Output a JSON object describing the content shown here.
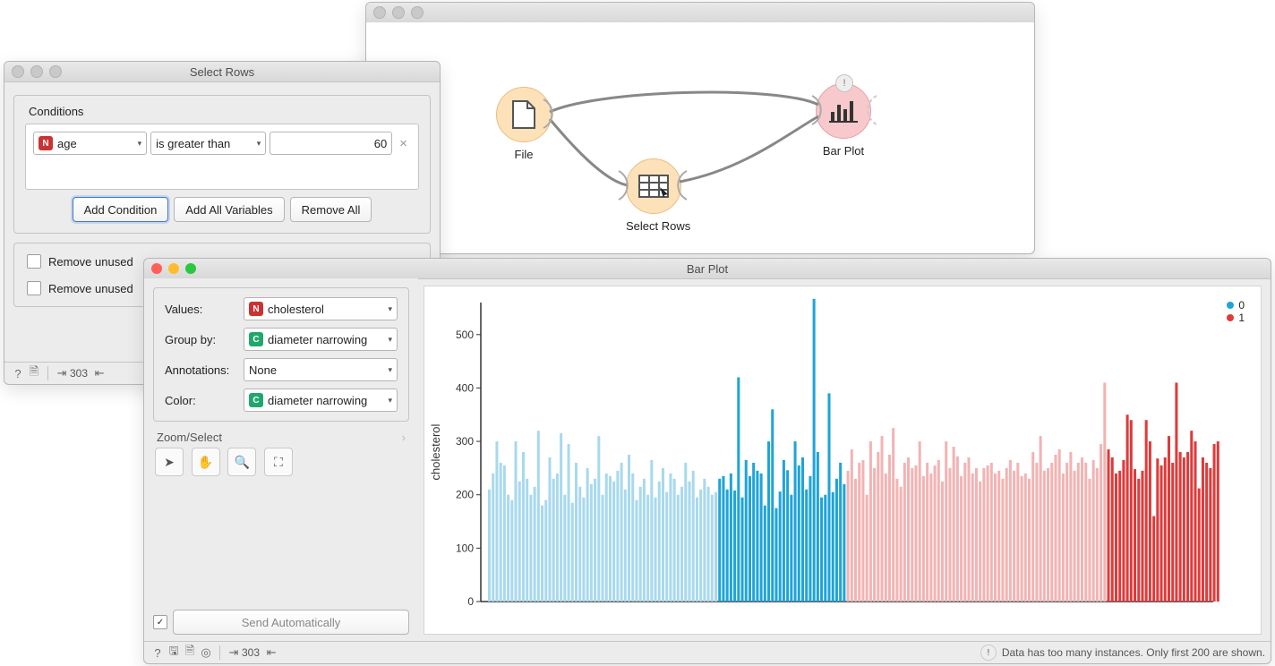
{
  "canvas_window": {
    "nodes": {
      "file_label": "File",
      "select_rows_label": "Select Rows",
      "barplot_label": "Bar Plot"
    }
  },
  "select_rows_window": {
    "title": "Select Rows",
    "conditions_heading": "Conditions",
    "condition": {
      "variable": "age",
      "operator": "is greater than",
      "value": "60"
    },
    "btn_add_condition": "Add Condition",
    "btn_add_all": "Add All Variables",
    "btn_remove_all": "Remove All",
    "chk_remove_unused_1": "Remove unused",
    "chk_remove_unused_2": "Remove unused",
    "status_count": "303"
  },
  "barplot_window": {
    "title": "Bar Plot",
    "labels": {
      "values": "Values:",
      "group_by": "Group by:",
      "annotations": "Annotations:",
      "color": "Color:"
    },
    "dropdowns": {
      "values": "cholesterol",
      "group_by": "diameter narrowing",
      "annotations": "None",
      "color": "diameter narrowing"
    },
    "zoom_select_heading": "Zoom/Select",
    "send_auto_label": "Send Automatically",
    "status_count": "303",
    "status_warning": "Data has too many instances. Only first 200 are shown.",
    "legend": {
      "item0": "0",
      "item1": "1"
    },
    "ylabel": "cholesterol",
    "yticks": [
      "0",
      "100",
      "200",
      "300",
      "400",
      "500"
    ]
  },
  "chart_data": {
    "type": "bar",
    "title": "",
    "xlabel": "",
    "ylabel": "cholesterol",
    "ylim": [
      0,
      560
    ],
    "series": [
      {
        "name": "0 unselected",
        "color": "#a8d9ee",
        "values": [
          210,
          240,
          300,
          260,
          255,
          200,
          190,
          300,
          225,
          280,
          230,
          200,
          215,
          320,
          180,
          190,
          270,
          230,
          240,
          315,
          200,
          295,
          185,
          260,
          215,
          195,
          250,
          220,
          230,
          310,
          200,
          240,
          235,
          225,
          245,
          260,
          210,
          275,
          240,
          190,
          215,
          230,
          200,
          265,
          195,
          225,
          250,
          205,
          240,
          230,
          200,
          215,
          260,
          225,
          245,
          195,
          210,
          230,
          215,
          200,
          205
        ]
      },
      {
        "name": "0 selected",
        "color": "#1fa4d8",
        "values": [
          230,
          235,
          210,
          240,
          208,
          420,
          195,
          265,
          235,
          260,
          245,
          240,
          180,
          300,
          360,
          175,
          206,
          265,
          246,
          200,
          300,
          255,
          270,
          210,
          235,
          567,
          280,
          195,
          200,
          390,
          205,
          230,
          260,
          220
        ]
      },
      {
        "name": "1 unselected",
        "color": "#f3b3b3",
        "values": [
          245,
          285,
          230,
          260,
          265,
          200,
          300,
          250,
          280,
          310,
          240,
          275,
          325,
          230,
          215,
          260,
          270,
          250,
          255,
          300,
          235,
          260,
          240,
          255,
          265,
          225,
          300,
          250,
          290,
          272,
          235,
          260,
          270,
          240,
          250,
          225,
          250,
          255,
          260,
          240,
          245,
          230,
          250,
          265,
          245,
          260,
          235,
          240,
          230,
          280,
          260,
          310,
          245,
          250,
          260,
          275,
          285,
          240,
          260,
          280,
          245,
          260,
          270,
          260,
          230,
          265,
          250,
          295,
          410
        ]
      },
      {
        "name": "1 selected",
        "color": "#e03a3a",
        "values": [
          285,
          270,
          240,
          245,
          265,
          350,
          340,
          248,
          230,
          245,
          340,
          300,
          160,
          268,
          255,
          270,
          310,
          260,
          410,
          280,
          270,
          280,
          320,
          300,
          212,
          270,
          260,
          250,
          295,
          300
        ]
      }
    ]
  }
}
